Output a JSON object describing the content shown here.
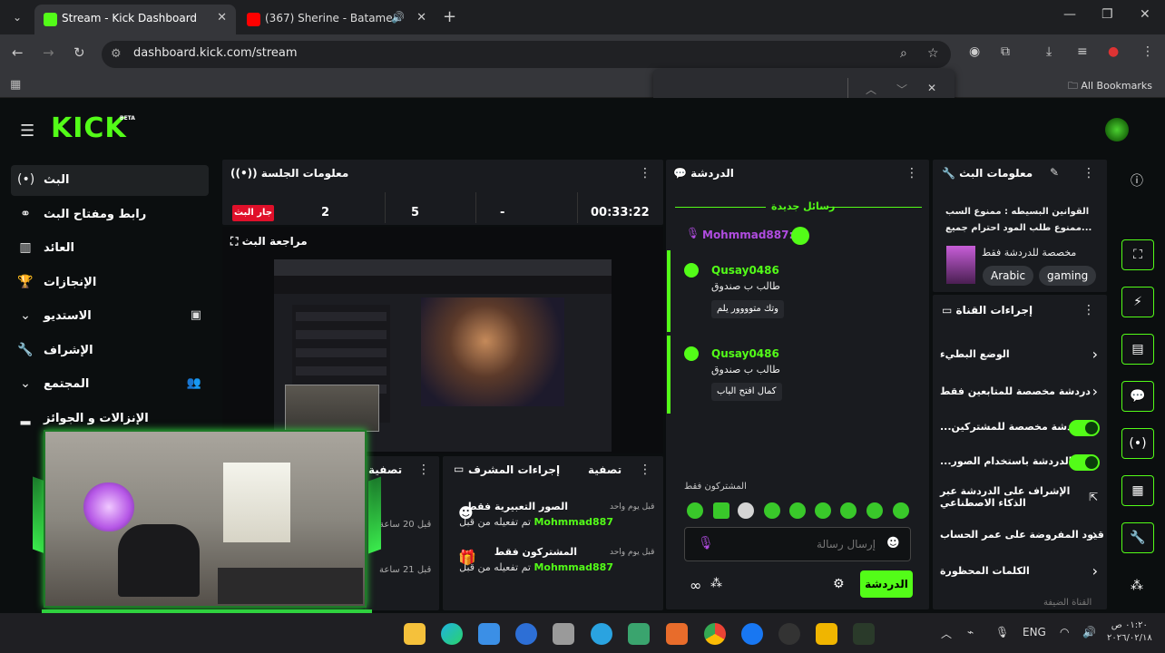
{
  "browser": {
    "tabs": [
      {
        "title": "Stream - Kick Dashboard",
        "favicon_color": "#53fc18"
      },
      {
        "title": "(367) Sherine - Batamenak",
        "favicon_color": "#ff0000"
      }
    ],
    "url": "dashboard.kick.com/stream",
    "bookmarks_label": "All Bookmarks"
  },
  "app": {
    "logo": "KICK",
    "logo_badge": "BETA",
    "accent_color": "#53fc18"
  },
  "sidebar": {
    "items": [
      {
        "label": "البث",
        "icon": "broadcast-icon"
      },
      {
        "label": "رابط ومفتاح البث",
        "icon": "link-icon"
      },
      {
        "label": "العائد",
        "icon": "revenue-icon"
      },
      {
        "label": "الإنجازات",
        "icon": "trophy-icon"
      },
      {
        "label": "الاستديو",
        "icon": "studio-icon"
      },
      {
        "label": "الإشراف",
        "icon": "wrench-icon"
      },
      {
        "label": "المجتمع",
        "icon": "community-icon"
      },
      {
        "label": "الإنزالات و الجوائز",
        "icon": "drops-icon"
      }
    ]
  },
  "session": {
    "title": "معلومات الجلسة",
    "live_label": "جار البث",
    "stats": [
      "2",
      "5",
      "-",
      "00:33:22"
    ]
  },
  "review": {
    "title": "مراجعة البث"
  },
  "filter": {
    "title": "تصفية"
  },
  "mod_actions": {
    "title": "إجراءات المشرف",
    "filter_label": "تصفية",
    "items": [
      {
        "title": "الصور التعبيرية فقط",
        "actor": "Mohmmad887",
        "suffix": "تم تفعيله من قبل",
        "ago": "قبل يوم واحد"
      },
      {
        "title": "المشتركون فقط",
        "actor": "Mohmmad887",
        "suffix": "تم تفعيله من قبل",
        "ago": "قبل يوم واحد"
      }
    ],
    "left_ago": [
      "قبل 20 ساعة",
      "قبل 21 ساعة"
    ]
  },
  "chat": {
    "title": "الدردشة",
    "new_messages": "رسائل جديدة",
    "pinned_user": "Mohmmad887:",
    "messages": [
      {
        "user": "Qusay0486",
        "text": "طالب ب صندوق",
        "chip": "وتك متوووور يلم"
      },
      {
        "user": "Qusay0486",
        "text": "طالب ب صندوق",
        "chip": "كمال افتح الباب"
      }
    ],
    "subscribers_only": "المشتركون فقط",
    "input_placeholder": "إرسال رسالة",
    "send_label": "الدردشة"
  },
  "stream_info": {
    "title": "معلومات البث",
    "description_line1": "القوانين البسيطه : ممنوع السب",
    "description_line2": "ممنوع طلب المود احترام جميع...",
    "category": "مخصصة للدردشة فقط",
    "tags": [
      "Arabic",
      "gaming"
    ]
  },
  "channel_actions": {
    "title": "إجراءات القناة",
    "items": [
      {
        "label": "الوضع البطيء",
        "control": "chevron"
      },
      {
        "label": "دردشة مخصصة للمتابعين فقط",
        "control": "chevron"
      },
      {
        "label": "...الدردشة مخصصة للمشتركين",
        "control": "toggle"
      },
      {
        "label": "...الدردشة باستخدام الصور",
        "control": "toggle"
      },
      {
        "label": "الإشراف على الدردشة عبر الذكاء الاصطناعي",
        "control": "external"
      },
      {
        "label": "قيود المفروضة على عمر الحساب",
        "control": "chevron"
      },
      {
        "label": "الكلمات المحظورة",
        "control": "chevron"
      }
    ],
    "footer": "القناة الضيفة"
  },
  "taskbar": {
    "lang": "ENG",
    "time": "٠١:٢٠ ص",
    "date": "٢٠٢٦/٠٢/١٨"
  }
}
